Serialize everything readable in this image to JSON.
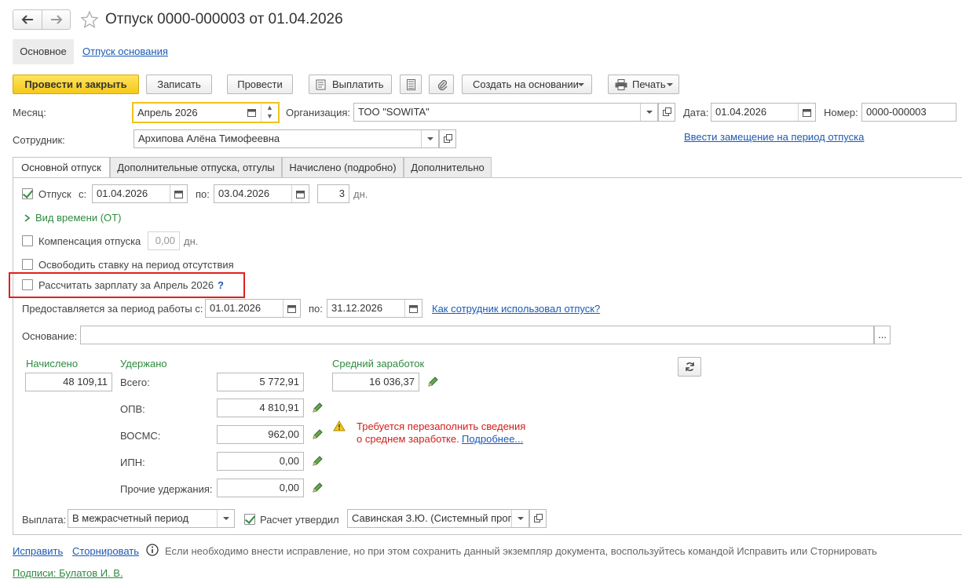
{
  "title": "Отпуск 0000-000003 от 01.04.2026",
  "nav": {
    "main_label": "Основное",
    "basis_link": "Отпуск основания"
  },
  "toolbar": {
    "post_close": "Провести и закрыть",
    "save": "Записать",
    "post": "Провести",
    "pay": "Выплатить",
    "create_based": "Создать на основании",
    "print": "Печать"
  },
  "header": {
    "month_label": "Месяц:",
    "month_value": "Апрель 2026",
    "org_label": "Организация:",
    "org_value": "ТОО \"SOWITA\"",
    "date_label": "Дата:",
    "date_value": "01.04.2026",
    "number_label": "Номер:",
    "number_value": "0000-000003",
    "employee_label": "Сотрудник:",
    "employee_value": "Архипова Алёна Тимофеевна",
    "replacement_link": "Ввести замещение на период отпуска"
  },
  "tabs": [
    "Основной отпуск",
    "Дополнительные отпуска, отгулы",
    "Начислено (подробно)",
    "Дополнительно"
  ],
  "main": {
    "vacation_label": "Отпуск",
    "from_label": "с:",
    "from_value": "01.04.2026",
    "to_label": "по:",
    "to_value": "03.04.2026",
    "days_value": "3",
    "days_unit": "дн.",
    "time_kind": "Вид времени (ОТ)",
    "compensation_label": "Компенсация отпуска",
    "compensation_value": "0,00",
    "compensation_unit": "дн.",
    "free_rate_label": "Освободить ставку на период отсутствия",
    "calc_salary_label": "Рассчитать зарплату за Апрель 2026",
    "help_mark": "?",
    "period_label": "Предоставляется за период работы с:",
    "period_from": "01.01.2026",
    "period_to_label": "по:",
    "period_to": "31.12.2026",
    "usage_link": "Как сотрудник использовал отпуск?",
    "basis_label": "Основание:",
    "basis_value": "",
    "basis_btn": "..."
  },
  "amounts": {
    "accrued_label": "Начислено",
    "accrued_value": "48 109,11",
    "withheld_label": "Удержано",
    "total_label": "Всего:",
    "total_value": "5 772,91",
    "opv_label": "ОПВ:",
    "opv_value": "4 810,91",
    "vosms_label": "ВОСМС:",
    "vosms_value": "962,00",
    "ipn_label": "ИПН:",
    "ipn_value": "0,00",
    "other_label": "Прочие удержания:",
    "other_value": "0,00",
    "avg_label": "Средний заработок",
    "avg_value": "16 036,37",
    "warning_line1": "Требуется перезаполнить сведения",
    "warning_line2": "о среднем заработке.",
    "warning_link": "Подробнее..."
  },
  "payment": {
    "label": "Выплата:",
    "value": "В межрасчетный период",
    "approved_label": "Расчет утвердил",
    "approver_value": "Савинская З.Ю. (Системный прог"
  },
  "footer": {
    "fix_link": "Исправить",
    "storno_link": "Сторнировать",
    "info_text": "Если необходимо внести исправление, но при этом сохранить данный экземпляр документа, воспользуйтесь командой Исправить или Сторнировать",
    "signatures_link": "Подписи: Булатов И. В."
  },
  "colors": {
    "accent_yellow": "#f5c91a",
    "link_blue": "#1b5ab5",
    "green": "#2e8b3f",
    "warning_red": "#d0201a",
    "highlight_red": "#e02020"
  }
}
